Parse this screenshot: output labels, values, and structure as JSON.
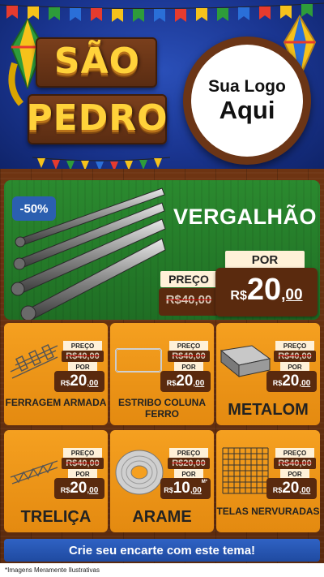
{
  "header": {
    "title_line1": "SÃO",
    "title_line2": "PEDRO",
    "logo_line1": "Sua Logo",
    "logo_line2": "Aqui"
  },
  "hero": {
    "discount_badge": "-50%",
    "product_name": "VERGALHÃO",
    "price_label": "PREÇO",
    "old_price": "R$40,00",
    "por_label": "POR",
    "new_price_currency": "R$",
    "new_price_int": "20",
    "new_price_dec": ",00"
  },
  "labels": {
    "mini_preco": "PREÇO",
    "mini_por": "POR",
    "currency": "R$"
  },
  "products": [
    {
      "name": "FERRAGEM ARMADA",
      "old": "R$40,00",
      "int": "20",
      "dec": ",00",
      "unit": ""
    },
    {
      "name": "ESTRIBO COLUNA FERRO",
      "old": "R$40,00",
      "int": "20",
      "dec": ",00",
      "unit": ""
    },
    {
      "name": "METALOM",
      "old": "R$40,00",
      "int": "20",
      "dec": ",00",
      "unit": ""
    },
    {
      "name": "TRELIÇA",
      "old": "R$40,00",
      "int": "20",
      "dec": ",00",
      "unit": ""
    },
    {
      "name": "ARAME",
      "old": "R$20,00",
      "int": "10",
      "dec": ",00",
      "unit": "M²"
    },
    {
      "name": "TELAS NERVURADAS",
      "old": "R$40,00",
      "int": "20",
      "dec": ",00",
      "unit": ""
    }
  ],
  "footer": {
    "cta": "Crie seu encarte com este tema!",
    "disclaimer": "*Imagens Meramente Ilustrativas"
  },
  "colors": {
    "header_blue": "#1a3590",
    "hero_green": "#2b8a2f",
    "card_orange": "#f5a020",
    "price_brown": "#5a2a0e",
    "cta_blue": "#2f62c4"
  }
}
